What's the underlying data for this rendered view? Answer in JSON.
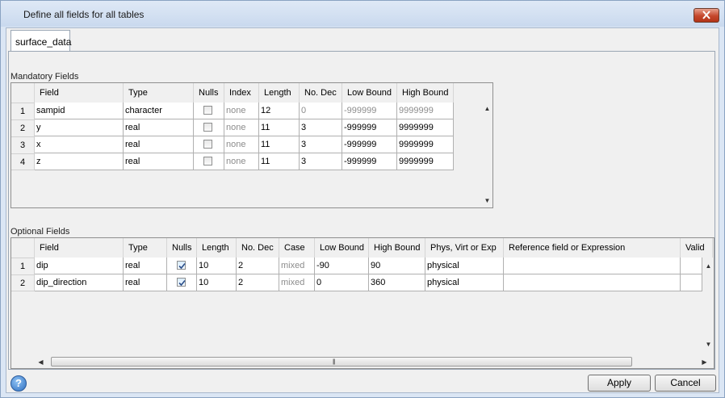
{
  "window": {
    "title": "Define all fields for all tables"
  },
  "tabs": [
    {
      "label": "surface_data"
    }
  ],
  "mandatory": {
    "label": "Mandatory Fields",
    "columns": [
      "Field",
      "Type",
      "Nulls",
      "Index",
      "Length",
      "No. Dec",
      "Low Bound",
      "High Bound"
    ],
    "rows": [
      {
        "num": "1",
        "field": "sampid",
        "type": "character",
        "nulls": false,
        "index": "none",
        "length": "12",
        "dec": "0",
        "low": "-999999",
        "high": "9999999"
      },
      {
        "num": "2",
        "field": "y",
        "type": "real",
        "nulls": false,
        "index": "none",
        "length": "11",
        "dec": "3",
        "low": "-999999",
        "high": "9999999"
      },
      {
        "num": "3",
        "field": "x",
        "type": "real",
        "nulls": false,
        "index": "none",
        "length": "11",
        "dec": "3",
        "low": "-999999",
        "high": "9999999"
      },
      {
        "num": "4",
        "field": "z",
        "type": "real",
        "nulls": false,
        "index": "none",
        "length": "11",
        "dec": "3",
        "low": "-999999",
        "high": "9999999"
      }
    ]
  },
  "optional": {
    "label": "Optional Fields",
    "columns": [
      "Field",
      "Type",
      "Nulls",
      "Length",
      "No. Dec",
      "Case",
      "Low Bound",
      "High Bound",
      "Phys, Virt or Exp",
      "Reference field or Expression",
      "Valid"
    ],
    "rows": [
      {
        "num": "1",
        "field": "dip",
        "type": "real",
        "nulls": true,
        "length": "10",
        "dec": "2",
        "case": "mixed",
        "low": "-90",
        "high": "90",
        "pve": "physical",
        "ref": "",
        "valid": ""
      },
      {
        "num": "2",
        "field": "dip_direction",
        "type": "real",
        "nulls": true,
        "length": "10",
        "dec": "2",
        "case": "mixed",
        "low": "0",
        "high": "360",
        "pve": "physical",
        "ref": "",
        "valid": ""
      }
    ]
  },
  "footer": {
    "apply_label": "Apply",
    "cancel_label": "Cancel",
    "help_label": "?"
  }
}
